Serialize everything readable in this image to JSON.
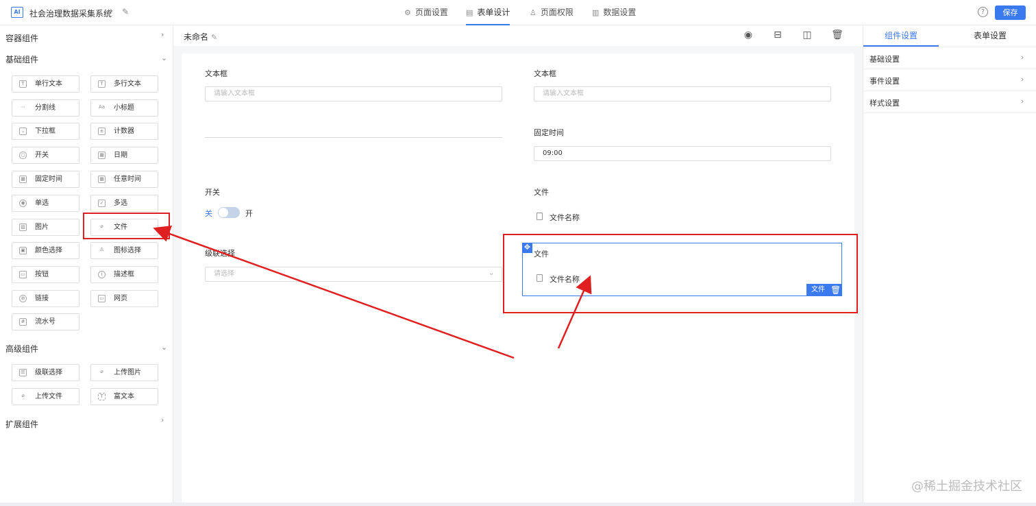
{
  "app": {
    "logo_text": "AI",
    "title": "社会治理数据采集系统"
  },
  "top_tabs": [
    {
      "label": "页面设置",
      "icon": "gear-icon"
    },
    {
      "label": "表单设计",
      "icon": "document-icon"
    },
    {
      "label": "页面权限",
      "icon": "lock-icon"
    },
    {
      "label": "数据设置",
      "icon": "bar-chart-icon"
    }
  ],
  "help_label": "?",
  "save_label": "保存",
  "left_panel": {
    "group_container": "容器组件",
    "group_basic": "基础组件",
    "group_advanced": "高级组件",
    "group_extension": "扩展组件",
    "basic_items": [
      "单行文本",
      "多行文本",
      "分割线",
      "小标题",
      "下拉框",
      "计数器",
      "开关",
      "日期",
      "固定时间",
      "任意时间",
      "单选",
      "多选",
      "图片",
      "文件",
      "颜色选择",
      "图标选择",
      "按钮",
      "描述框",
      "链接",
      "网页",
      "流水号"
    ],
    "advanced_items": [
      "级联选择",
      "上传图片",
      "上传文件",
      "富文本"
    ]
  },
  "canvas_header": {
    "form_name": "未命名"
  },
  "form": {
    "text1_label": "文本框",
    "text1_placeholder": "请输入文本框",
    "text2_label": "文本框",
    "text2_placeholder": "请输入文本框",
    "fixed_time_label": "固定时间",
    "fixed_time_value": "09:00",
    "switch_label": "开关",
    "switch_off": "关",
    "switch_on": "开",
    "file1_label": "文件",
    "file1_name": "文件名称",
    "cascade_label": "级联选择",
    "cascade_placeholder": "请选择",
    "file2_label": "文件",
    "file2_name": "文件名称",
    "selected_tag": "文件"
  },
  "right_panel": {
    "tab_component": "组件设置",
    "tab_form": "表单设置",
    "sections": [
      "基础设置",
      "事件设置",
      "样式设置"
    ]
  },
  "watermark": "@稀土掘金技术社区",
  "colors": {
    "accent": "#3a79ee",
    "annotation": "#e02020"
  }
}
